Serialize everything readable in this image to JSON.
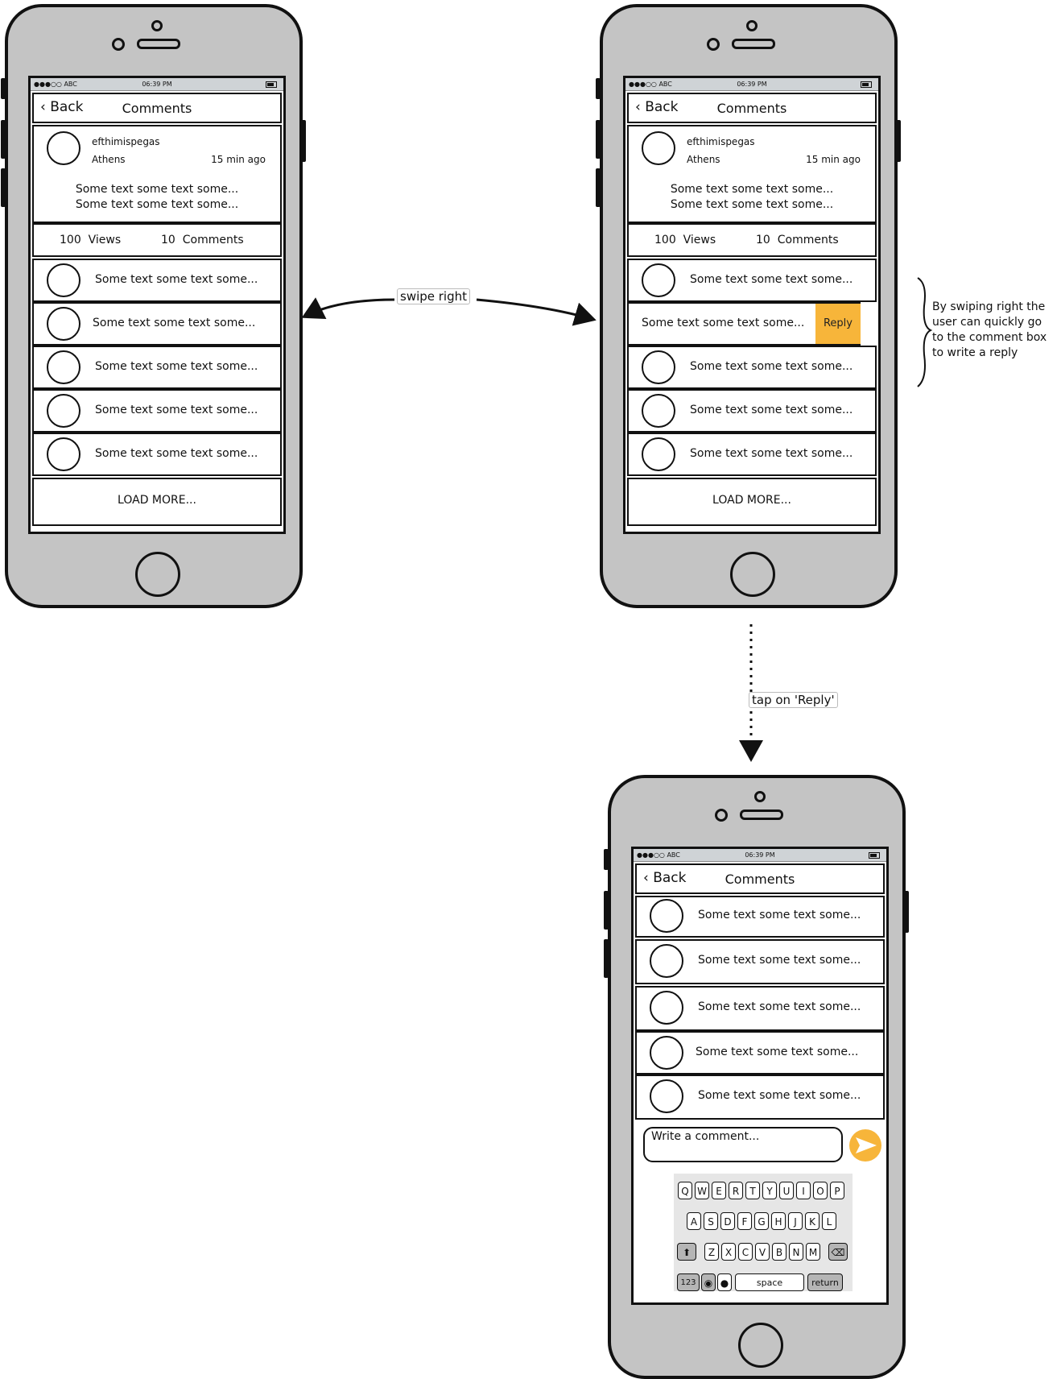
{
  "status_bar": {
    "carrier": "●●●○○ ABC",
    "time": "06:39 PM"
  },
  "nav": {
    "back_label": "Back",
    "title": "Comments"
  },
  "post": {
    "username": "efthimispegas",
    "location": "Athens",
    "time_ago": "15 min ago",
    "text_line1": "Some text some text some...",
    "text_line2": "Some text some text some...",
    "views_count": "100",
    "views_label": "Views",
    "comments_count": "10",
    "comments_label": "Comments"
  },
  "comment_text": "Some text some text some...",
  "load_more": "LOAD MORE...",
  "reply_label": "Reply",
  "compose_placeholder": "Write a comment...",
  "annotations": {
    "swipe": "swipe right",
    "tap": "tap on 'Reply'",
    "note_line1": "By swiping right the",
    "note_line2": "user can quickly go",
    "note_line3": "to the comment box",
    "note_line4": "to write a reply"
  },
  "keyboard": {
    "row1": [
      "Q",
      "W",
      "E",
      "R",
      "T",
      "Y",
      "U",
      "I",
      "O",
      "P"
    ],
    "row2": [
      "A",
      "S",
      "D",
      "F",
      "G",
      "H",
      "J",
      "K",
      "L"
    ],
    "row3": [
      "Z",
      "X",
      "C",
      "V",
      "B",
      "N",
      "M"
    ],
    "num_key": "123",
    "space_key": "space",
    "return_key": "return"
  },
  "colors": {
    "accent": "#f7b53a",
    "phone_body": "#c4c4c4",
    "status_bar": "#cfd3d6"
  }
}
